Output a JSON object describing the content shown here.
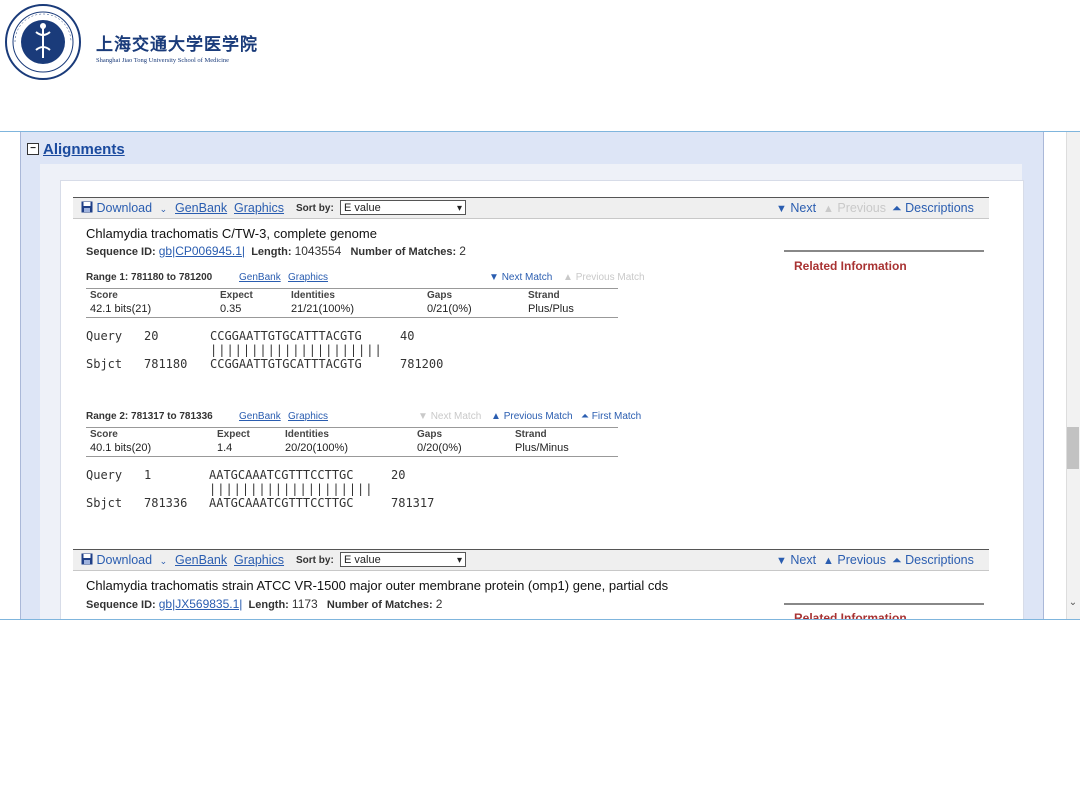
{
  "logo": {
    "cn_name": "上海交通大学医学院",
    "en_name": "Shanghai Jiao Tong University School of Medicine",
    "seal_text": "SJTU SoM"
  },
  "section": {
    "title": "Alignments",
    "toggle_symbol": "−"
  },
  "hits": [
    {
      "toolbar": {
        "download": "Download",
        "genbank": "GenBank",
        "graphics": "Graphics",
        "sort_label": "Sort by:",
        "sort_value": "E value",
        "next": "Next",
        "previous": "Previous",
        "descriptions": "Descriptions",
        "previous_enabled": false
      },
      "title": "Chlamydia trachomatis C/TW-3, complete genome",
      "seq_id_label": "Sequence ID:",
      "seq_id": "gb|CP006945.1|",
      "length_label": "Length:",
      "length": "1043554",
      "matches_label": "Number of Matches:",
      "matches": "2",
      "related_info": "Related Information",
      "ranges": [
        {
          "label": "Range 1: 781180 to 781200",
          "genbank": "GenBank",
          "graphics": "Graphics",
          "next_match": "Next Match",
          "previous_match": "Previous Match",
          "headers": [
            "Score",
            "Expect",
            "Identities",
            "Gaps",
            "Strand"
          ],
          "values": [
            "42.1 bits(21)",
            "0.35",
            "21/21(100%)",
            "0/21(0%)",
            "Plus/Plus"
          ],
          "query": {
            "label": "Query",
            "start": "20",
            "seq": "CCGGAATTGTGCATTTACGTG",
            "end": "40"
          },
          "bars": "|||||||||||||||||||||",
          "sbjct": {
            "label": "Sbjct",
            "start": "781180",
            "seq": "CCGGAATTGTGCATTTACGTG",
            "end": "781200"
          }
        },
        {
          "label": "Range 2: 781317 to 781336",
          "genbank": "GenBank",
          "graphics": "Graphics",
          "next_match": "Next Match",
          "previous_match": "Previous Match",
          "first_match": "First Match",
          "headers": [
            "Score",
            "Expect",
            "Identities",
            "Gaps",
            "Strand"
          ],
          "values": [
            "40.1 bits(20)",
            "1.4",
            "20/20(100%)",
            "0/20(0%)",
            "Plus/Minus"
          ],
          "query": {
            "label": "Query",
            "start": "1",
            "seq": "AATGCAAATCGTTTCCTTGC",
            "end": "20"
          },
          "bars": "||||||||||||||||||||",
          "sbjct": {
            "label": "Sbjct",
            "start": "781336",
            "seq": "AATGCAAATCGTTTCCTTGC",
            "end": "781317"
          }
        }
      ]
    },
    {
      "toolbar": {
        "download": "Download",
        "genbank": "GenBank",
        "graphics": "Graphics",
        "sort_label": "Sort by:",
        "sort_value": "E value",
        "next": "Next",
        "previous": "Previous",
        "descriptions": "Descriptions",
        "previous_enabled": true
      },
      "title": "Chlamydia trachomatis strain ATCC VR-1500 major outer membrane protein (omp1) gene, partial cds",
      "seq_id_label": "Sequence ID:",
      "seq_id": "gb|JX569835.1|",
      "length_label": "Length:",
      "length": "1173",
      "matches_label": "Number of Matches:",
      "matches": "2",
      "related_info": "Related Information"
    }
  ],
  "colors": {
    "link": "#2a5db0",
    "related": "#a83232",
    "panel_bg": "#dde5f6"
  }
}
